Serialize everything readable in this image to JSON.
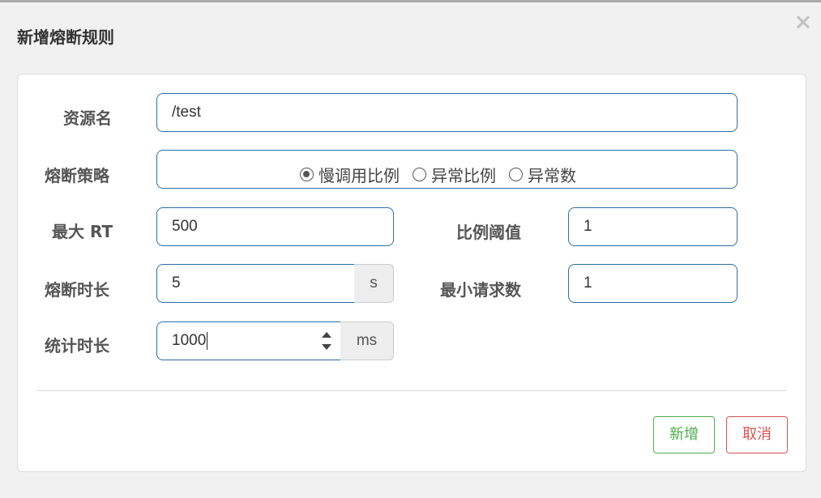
{
  "dialog": {
    "title": "新增熔断规则",
    "close_label": "×"
  },
  "form": {
    "resource": {
      "label": "资源名",
      "value": "/test"
    },
    "strategy": {
      "label": "熔断策略",
      "options": [
        {
          "label": "慢调用比例",
          "checked": true
        },
        {
          "label": "异常比例",
          "checked": false
        },
        {
          "label": "异常数",
          "checked": false
        }
      ]
    },
    "max_rt": {
      "label": "最大 RT",
      "value": "500"
    },
    "ratio_threshold": {
      "label": "比例阈值",
      "value": "1"
    },
    "break_duration": {
      "label": "熔断时长",
      "value": "5",
      "unit": "s"
    },
    "min_requests": {
      "label": "最小请求数",
      "value": "1"
    },
    "stat_duration": {
      "label": "统计时长",
      "value": "1000",
      "unit": "ms"
    }
  },
  "buttons": {
    "add_label": "新增",
    "cancel_label": "取消"
  },
  "colors": {
    "input_border": "#2e6da4",
    "add_button": "#4cae4c",
    "cancel_button": "#d9534f"
  }
}
